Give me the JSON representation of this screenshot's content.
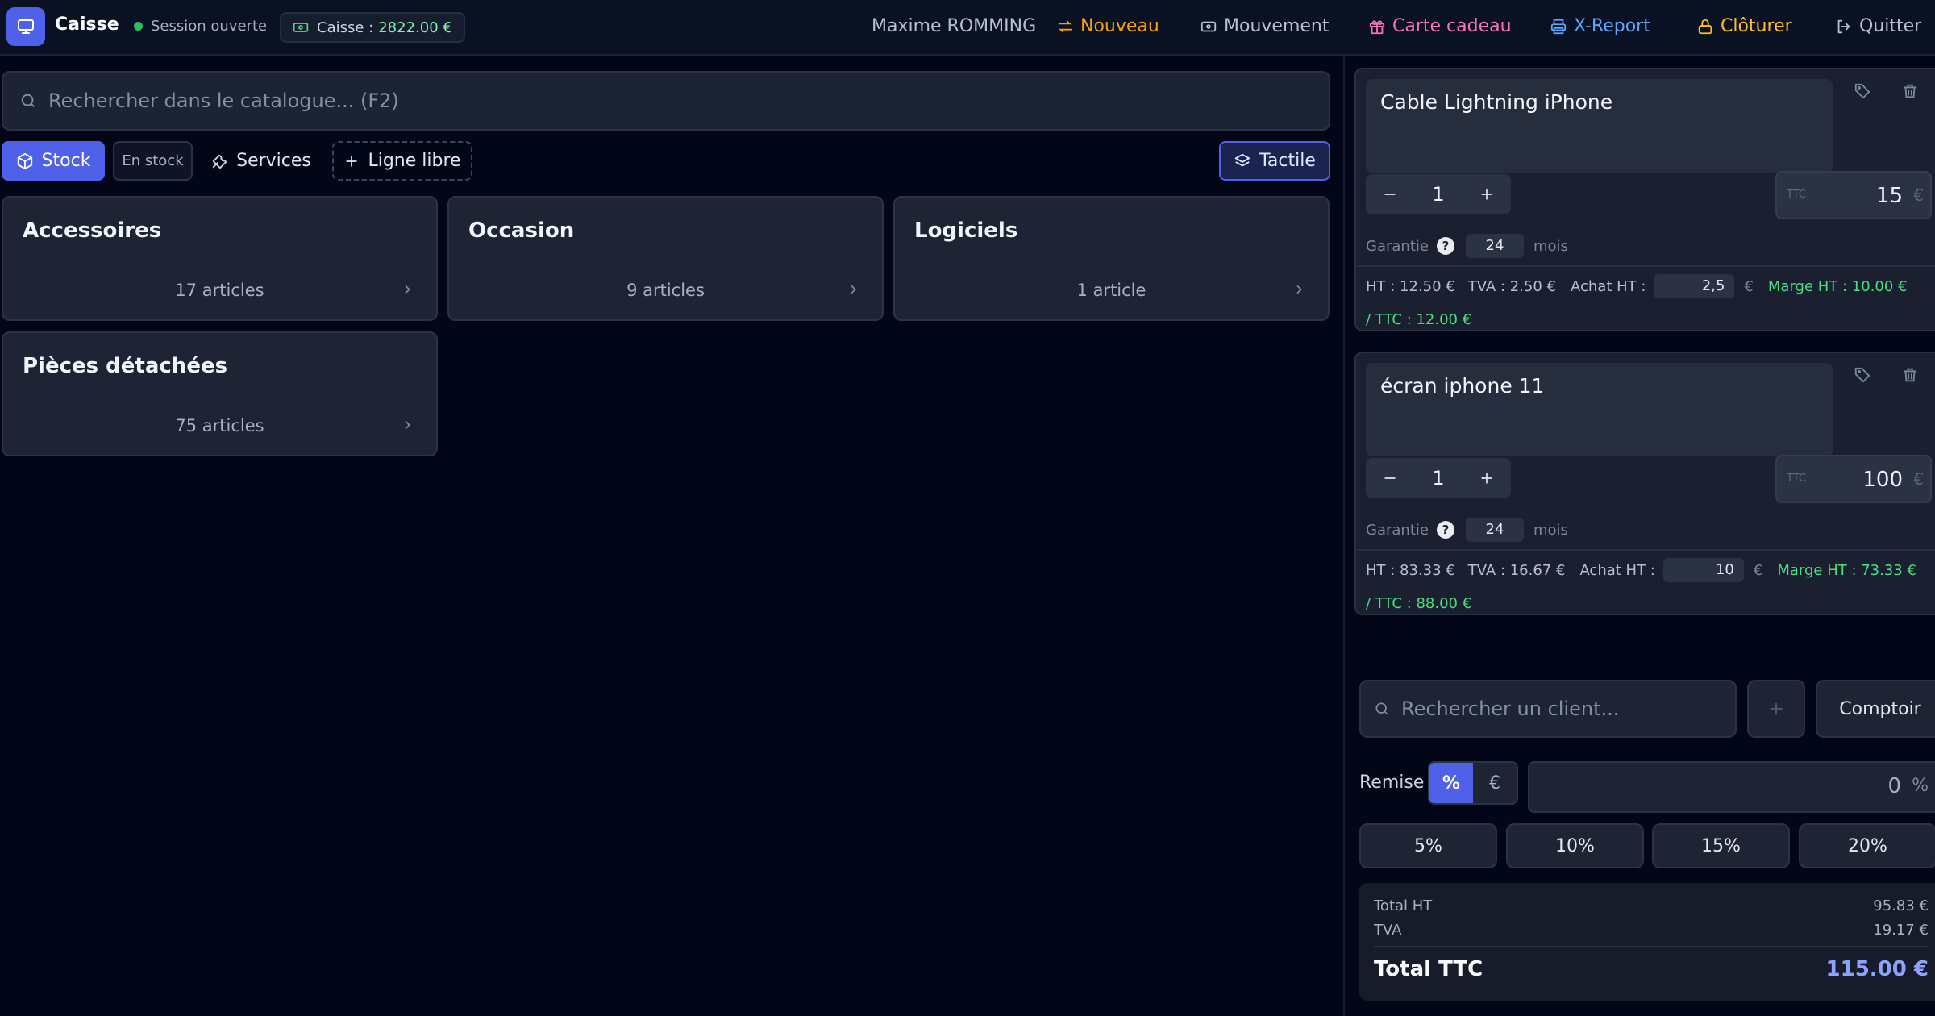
{
  "brand": {
    "name": "Caisse"
  },
  "session": {
    "label": "Session ouverte"
  },
  "register": {
    "label": "Caisse :",
    "amount": "2822.00 €"
  },
  "user": {
    "name": "Maxime ROMMING"
  },
  "nav": [
    {
      "label": "Nouveau",
      "color": "#f59e0b"
    },
    {
      "label": "Mouvement",
      "color": "#cbd5e1"
    },
    {
      "label": "Carte cadeau",
      "color": "#f472b6"
    },
    {
      "label": "X-Report",
      "color": "#60a5fa"
    },
    {
      "label": "Clôturer",
      "color": "#fbbf24"
    },
    {
      "label": "Quitter",
      "color": "#cbd5e1"
    }
  ],
  "catalog": {
    "search_placeholder": "Rechercher dans le catalogue... (F2)"
  },
  "filters": {
    "stock": "Stock",
    "en_stock": "En stock",
    "services": "Services",
    "ligne_libre": "Ligne libre",
    "tactile": "Tactile"
  },
  "categories": [
    {
      "name": "Accessoires",
      "count": "17 articles"
    },
    {
      "name": "Occasion",
      "count": "9 articles"
    },
    {
      "name": "Logiciels",
      "count": "1 article"
    },
    {
      "name": "Pièces détachées",
      "count": "75 articles"
    }
  ],
  "cart": {
    "ttc_label": "TTC",
    "currency": "€",
    "garantie_label": "Garantie",
    "mois_label": "mois",
    "items": [
      {
        "name": "Cable Lightning iPhone",
        "qty": "1",
        "price": "15",
        "garantie": "24",
        "ht": "HT : 12.50 €",
        "tva": "TVA : 2.50 €",
        "achat_label": "Achat HT :",
        "achat": "2,5",
        "marge": "Marge HT : 10.00 €",
        "marge_ttc": "/ TTC : 12.00 €"
      },
      {
        "name": "écran iphone 11",
        "qty": "1",
        "price": "100",
        "garantie": "24",
        "ht": "HT : 83.33 €",
        "tva": "TVA : 16.67 €",
        "achat_label": "Achat HT :",
        "achat": "10",
        "marge": "Marge HT : 73.33 €",
        "marge_ttc": "/ TTC : 88.00 €"
      }
    ]
  },
  "client": {
    "search_placeholder": "Rechercher un client...",
    "comptoir": "Comptoir"
  },
  "remise": {
    "label": "Remise",
    "pct": "%",
    "eur": "€",
    "value": "0",
    "unit": "%",
    "presets": [
      "5%",
      "10%",
      "15%",
      "20%"
    ]
  },
  "totals": {
    "ht_label": "Total HT",
    "ht": "95.83 €",
    "tva_label": "TVA",
    "tva": "19.17 €",
    "ttc_label": "Total TTC",
    "ttc": "115.00 €"
  },
  "colors": {
    "accent": "#4f61e8",
    "success": "#22c55e",
    "marge": "#4ade80"
  }
}
